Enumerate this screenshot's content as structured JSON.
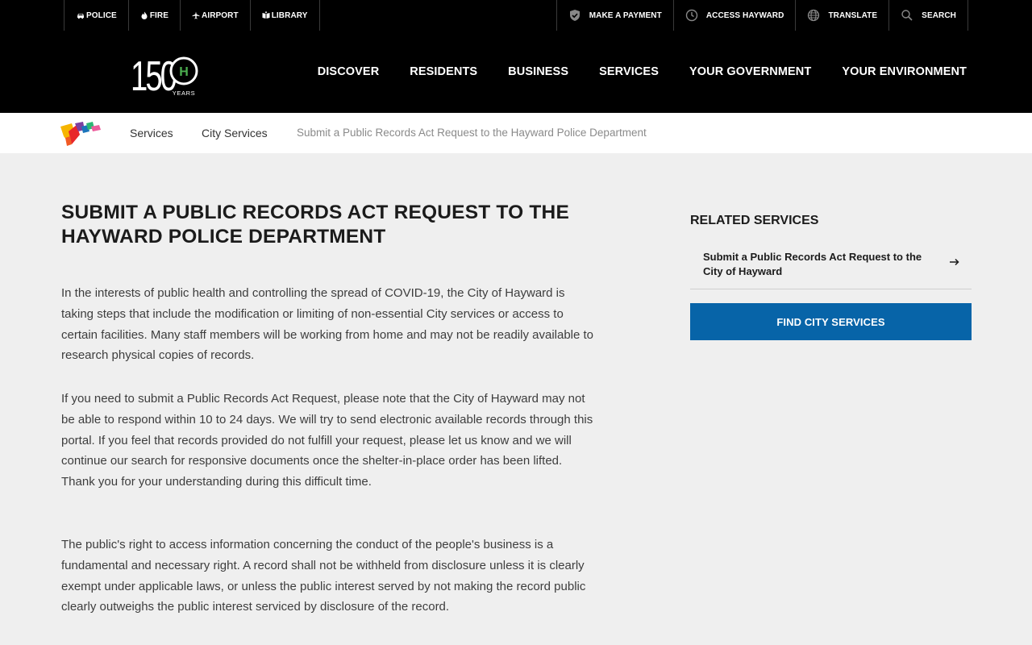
{
  "utility": {
    "left": [
      {
        "label": "POLICE",
        "icon": "police-car-icon"
      },
      {
        "label": "FIRE",
        "icon": "fire-icon"
      },
      {
        "label": "AIRPORT",
        "icon": "airplane-icon"
      },
      {
        "label": "LIBRARY",
        "icon": "book-icon"
      }
    ],
    "right": [
      {
        "label": "MAKE A PAYMENT",
        "icon": "shield-check-icon"
      },
      {
        "label": "ACCESS HAYWARD",
        "icon": "clock-icon"
      },
      {
        "label": "TRANSLATE",
        "icon": "globe-icon"
      },
      {
        "label": "SEARCH",
        "icon": "search-icon"
      }
    ]
  },
  "logo": {
    "number": "150",
    "letter": "H",
    "sub": "YEARS",
    "accent": "#4caf50"
  },
  "nav": [
    "DISCOVER",
    "RESIDENTS",
    "BUSINESS",
    "SERVICES",
    "YOUR GOVERNMENT",
    "YOUR ENVIRONMENT"
  ],
  "breadcrumb": {
    "items": [
      "Services",
      "City Services"
    ],
    "current": "Submit a Public Records Act Request to the Hayward Police Department"
  },
  "main": {
    "title": "SUBMIT A PUBLIC RECORDS ACT REQUEST TO THE HAYWARD POLICE DEPARTMENT",
    "paragraphs": [
      "In the interests of public health and controlling the spread of COVID-19, the City of Hayward is taking steps that include the modification or limiting of non-essential City services or access to certain facilities. Many staff members will be working from home and may not be readily available to research physical copies of records.",
      "If you need to submit a Public Records Act Request, please note that the City of Hayward may not be able to respond within 10 to 24 days.  We will try to send electronic available records through this portal.  If you feel that records provided do not fulfill your request, please let us know and we will continue our search for responsive documents once the shelter-in-place order has been lifted. Thank you for your understanding during this difficult time.",
      "The public's right to access information concerning the conduct of the people's business is a fundamental and necessary right. A record shall not be withheld from disclosure unless it is clearly exempt under applicable laws, or unless the public interest served by not making the record public clearly outweighs the public interest serviced by disclosure of the record."
    ]
  },
  "sidebar": {
    "heading": "RELATED SERVICES",
    "link": "Submit a Public Records Act Request to the City of Hayward",
    "link_icon": "arrow-right-icon",
    "button": "FIND CITY SERVICES",
    "button_color": "#0764a8"
  }
}
